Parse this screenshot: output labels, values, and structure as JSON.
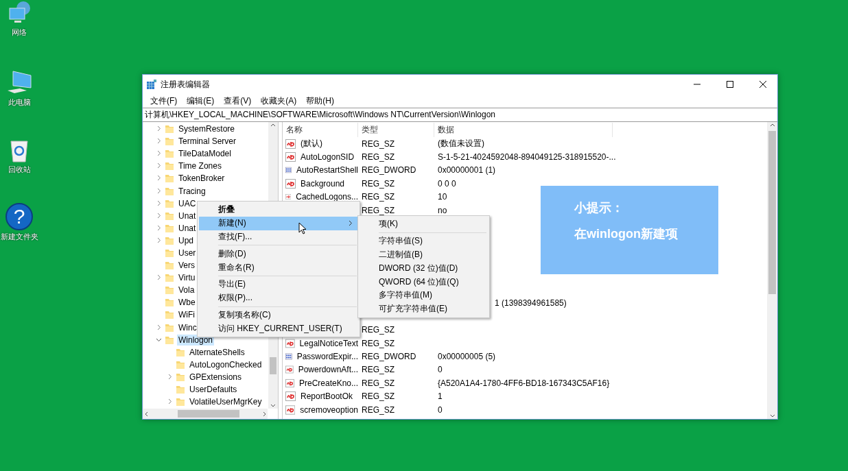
{
  "desktop_icons": [
    {
      "kind": "network",
      "label": "网络"
    },
    {
      "kind": "computer",
      "label": "此电脑"
    },
    {
      "kind": "recycle",
      "label": "回收站"
    },
    {
      "kind": "help",
      "glyph": "?",
      "label": "新建文件夹"
    }
  ],
  "window": {
    "title": "注册表编辑器"
  },
  "menu_bar": [
    "文件(F)",
    "编辑(E)",
    "查看(V)",
    "收藏夹(A)",
    "帮助(H)"
  ],
  "address": "计算机\\HKEY_LOCAL_MACHINE\\SOFTWARE\\Microsoft\\Windows NT\\CurrentVersion\\Winlogon",
  "tree": [
    {
      "label": "SystemRestore",
      "expandable": true,
      "selected": false
    },
    {
      "label": "Terminal Server",
      "expandable": true,
      "selected": false
    },
    {
      "label": "TileDataModel",
      "expandable": true,
      "selected": false
    },
    {
      "label": "Time Zones",
      "expandable": true,
      "selected": false
    },
    {
      "label": "TokenBroker",
      "expandable": true,
      "selected": false
    },
    {
      "label": "Tracing",
      "expandable": true,
      "selected": false
    },
    {
      "label": "UAC",
      "expandable": true,
      "selected": false
    },
    {
      "label": "Unat",
      "expandable": true,
      "selected": false
    },
    {
      "label": "Unat",
      "expandable": true,
      "selected": false
    },
    {
      "label": "Upd",
      "expandable": true,
      "selected": false
    },
    {
      "label": "User",
      "expandable": false,
      "selected": false
    },
    {
      "label": "Vers",
      "expandable": false,
      "selected": false
    },
    {
      "label": "Virtu",
      "expandable": true,
      "selected": false
    },
    {
      "label": "Vola",
      "expandable": false,
      "selected": false
    },
    {
      "label": "Wbe",
      "expandable": false,
      "selected": false
    },
    {
      "label": "WiFi",
      "expandable": false,
      "selected": false
    },
    {
      "label": "Winc",
      "expandable": true,
      "selected": false
    },
    {
      "label": "Winlogon",
      "expandable": true,
      "expanded": true,
      "selected": true,
      "children": [
        {
          "label": "AlternateShells",
          "expandable": false,
          "selected": false
        },
        {
          "label": "AutoLogonChecked",
          "expandable": false,
          "selected": false
        },
        {
          "label": "GPExtensions",
          "expandable": true,
          "selected": false
        },
        {
          "label": "UserDefaults",
          "expandable": false,
          "selected": false
        },
        {
          "label": "VolatileUserMgrKey",
          "expandable": true,
          "selected": false
        }
      ]
    }
  ],
  "columns": [
    "名称",
    "类型",
    "数据"
  ],
  "values": [
    {
      "kind": "string",
      "name": "(默认)",
      "type": "REG_SZ",
      "data": "(数值未设置)"
    },
    {
      "kind": "string",
      "name": "AutoLogonSID",
      "type": "REG_SZ",
      "data": "S-1-5-21-4024592048-894049125-318915520-..."
    },
    {
      "kind": "binary",
      "name": "AutoRestartShell",
      "type": "REG_DWORD",
      "data": "0x00000001 (1)"
    },
    {
      "kind": "string",
      "name": "Background",
      "type": "REG_SZ",
      "data": "0 0 0"
    },
    {
      "kind": "string",
      "name": "CachedLogons...",
      "type": "REG_SZ",
      "data": "10"
    },
    {
      "type": "REG_SZ",
      "data": "no"
    },
    {
      "kind": "covered"
    },
    {
      "kind": "covered"
    },
    {
      "kind": "covered"
    },
    {
      "kind": "covered"
    },
    {
      "kind": "covered"
    },
    {
      "kind": "covered"
    },
    {
      "data": "1 (1398394961585)",
      "data_partly_hidden": true
    },
    {
      "kind": "covered"
    },
    {
      "type": "REG_SZ"
    },
    {
      "kind": "string",
      "name": "LegalNoticeText",
      "type": "REG_SZ"
    },
    {
      "kind": "binary",
      "name": "PasswordExpir...",
      "type": "REG_DWORD",
      "data": "0x00000005 (5)"
    },
    {
      "kind": "string",
      "name": "PowerdownAft...",
      "type": "REG_SZ",
      "data": "0"
    },
    {
      "kind": "string",
      "name": "PreCreateKno...",
      "type": "REG_SZ",
      "data": "{A520A1A4-1780-4FF6-BD18-167343C5AF16}"
    },
    {
      "kind": "string",
      "name": "ReportBootOk",
      "type": "REG_SZ",
      "data": "1"
    },
    {
      "kind": "string",
      "name": "scremoveoption",
      "type": "REG_SZ",
      "data": "0"
    }
  ],
  "context_menu": [
    {
      "kind": "item",
      "label": "折叠",
      "default": true,
      "highlighted": false,
      "submenu": false
    },
    {
      "kind": "item",
      "label": "新建(N)",
      "default": false,
      "highlighted": true,
      "submenu": true
    },
    {
      "kind": "item",
      "label": "查找(F)...",
      "default": false,
      "highlighted": false,
      "submenu": false
    },
    {
      "kind": "separator"
    },
    {
      "kind": "item",
      "label": "删除(D)",
      "default": false,
      "highlighted": false,
      "submenu": false
    },
    {
      "kind": "item",
      "label": "重命名(R)",
      "default": false,
      "highlighted": false,
      "submenu": false
    },
    {
      "kind": "separator"
    },
    {
      "kind": "item",
      "label": "导出(E)",
      "default": false,
      "highlighted": false,
      "submenu": false
    },
    {
      "kind": "item",
      "label": "权限(P)...",
      "default": false,
      "highlighted": false,
      "submenu": false
    },
    {
      "kind": "separator"
    },
    {
      "kind": "item",
      "label": "复制项名称(C)",
      "default": false,
      "highlighted": false,
      "submenu": false
    },
    {
      "kind": "item",
      "label": "访问 HKEY_CURRENT_USER(T)",
      "default": false,
      "highlighted": false,
      "submenu": false
    }
  ],
  "submenu": [
    {
      "kind": "item",
      "label": "项(K)"
    },
    {
      "kind": "separator"
    },
    {
      "kind": "item",
      "label": "字符串值(S)"
    },
    {
      "kind": "item",
      "label": "二进制值(B)"
    },
    {
      "kind": "item",
      "label": "DWORD (32 位)值(D)"
    },
    {
      "kind": "item",
      "label": "QWORD (64 位)值(Q)"
    },
    {
      "kind": "item",
      "label": "多字符串值(M)"
    },
    {
      "kind": "item",
      "label": "可扩充字符串值(E)"
    }
  ],
  "tip": {
    "title": "小提示：",
    "text": "在winlogon新建项"
  }
}
